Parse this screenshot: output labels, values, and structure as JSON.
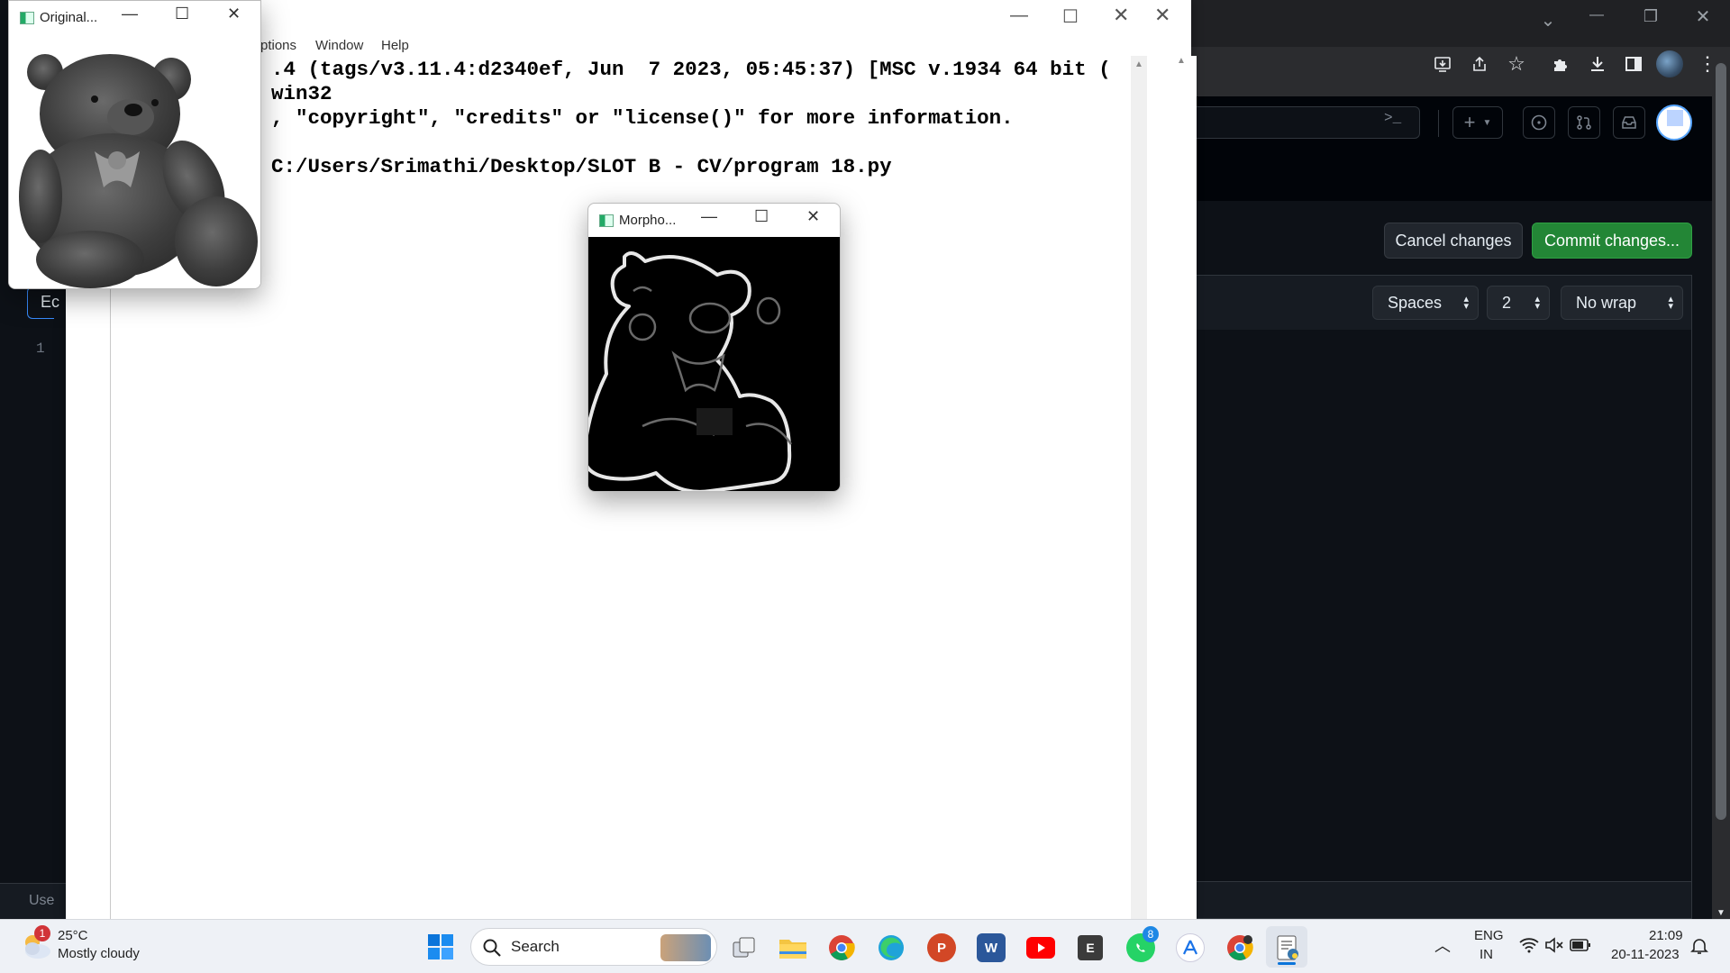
{
  "chrome": {
    "window_controls": [
      "⌄",
      "—",
      "❐",
      "✕"
    ],
    "toolbar_icons": [
      "install-icon",
      "share-icon",
      "star-icon",
      "extensions-icon",
      "download-icon",
      "sidebar-icon",
      "profile-avatar"
    ]
  },
  "github": {
    "terminal_label": ">_",
    "plus_label": "+",
    "cancel_label": "Cancel changes",
    "commit_label": "Commit changes...",
    "indent_mode": "Spaces",
    "indent_size": "2",
    "wrap_mode": "No wrap",
    "left_tab_label": "Ec",
    "line_number": "1",
    "footer_text": "Use"
  },
  "idle": {
    "menu": [
      "ptions",
      "Window",
      "Help"
    ],
    "lines": [
      ".4 (tags/v3.11.4:d2340ef, Jun  7 2023, 05:45:37) [MSC v.1934 64 bit (",
      "win32",
      ", \"copyright\", \"credits\" or \"license()\" for more information.",
      "",
      "C:/Users/Srimathi/Desktop/SLOT B - CV/program 18.py"
    ]
  },
  "windows": {
    "original_title": "Original...",
    "morpho_title": "Morpho..."
  },
  "taskbar": {
    "weather_temp": "25°C",
    "weather_desc": "Mostly cloudy",
    "weather_badge": "1",
    "search_placeholder": "Search",
    "whatsapp_badge": "8",
    "lang_top": "ENG",
    "lang_bottom": "IN",
    "time": "21:09",
    "date": "20-11-2023",
    "word_letter": "W",
    "ppt_letter": "P",
    "e_letter": "E"
  },
  "colors": {
    "commit_green": "#238636",
    "github_bg": "#0d1117",
    "chrome_dark": "#202124"
  }
}
